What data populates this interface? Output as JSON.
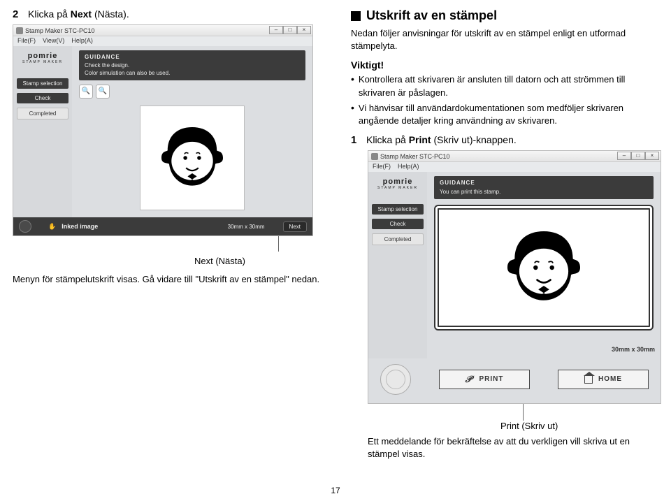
{
  "left": {
    "step_num": "2",
    "step_text_pre": "Klicka på ",
    "step_text_bold": "Next",
    "step_text_post": " (Nästa).",
    "caption_label": "Next (Nästa)",
    "caption_body": "Menyn för stämpelutskrift visas. Gå vidare till \"Utskrift av en stämpel\" nedan."
  },
  "app1": {
    "title": "Stamp Maker STC-PC10",
    "menu": [
      "File(F)",
      "View(V)",
      "Help(A)"
    ],
    "brand": "pomrie",
    "brand_sub": "STAMP MAKER",
    "side_items": [
      "Stamp selection",
      "Check",
      "Completed"
    ],
    "guidance_title": "GUIDANCE",
    "guidance_l1": "Check the design.",
    "guidance_l2": "Color simulation can also be used.",
    "inked_label": "Inked image",
    "size_label": "30mm x 30mm",
    "next_label": "Next"
  },
  "right": {
    "heading": "Utskrift av en stämpel",
    "intro": "Nedan följer anvisningar för utskrift av en stämpel enligt en utformad stämpelyta.",
    "important": "Viktigt!",
    "bullets": [
      "Kontrollera att skrivaren är ansluten till datorn och att strömmen till skrivaren är påslagen.",
      "Vi hänvisar till användardokumentationen som medföljer skrivaren angående detaljer kring användning av skrivaren."
    ],
    "step_num": "1",
    "step_text_pre": "Klicka på ",
    "step_text_bold": "Print",
    "step_text_post": " (Skriv ut)-knappen."
  },
  "app2": {
    "title": "Stamp Maker STC-PC10",
    "menu": [
      "File(F)",
      "Help(A)"
    ],
    "brand": "pomrie",
    "brand_sub": "STAMP MAKER",
    "side_items": [
      "Stamp selection",
      "Check",
      "Completed"
    ],
    "guidance_title": "GUIDANCE",
    "guidance_l1": "You can print this stamp.",
    "size_label": "30mm x 30mm",
    "print_label": "PRINT",
    "home_label": "HOME"
  },
  "annot2": {
    "label": "Print (Skriv ut)",
    "body": "Ett meddelande för bekräftelse av att du verkligen vill skriva ut en stämpel visas."
  },
  "page_number": "17"
}
